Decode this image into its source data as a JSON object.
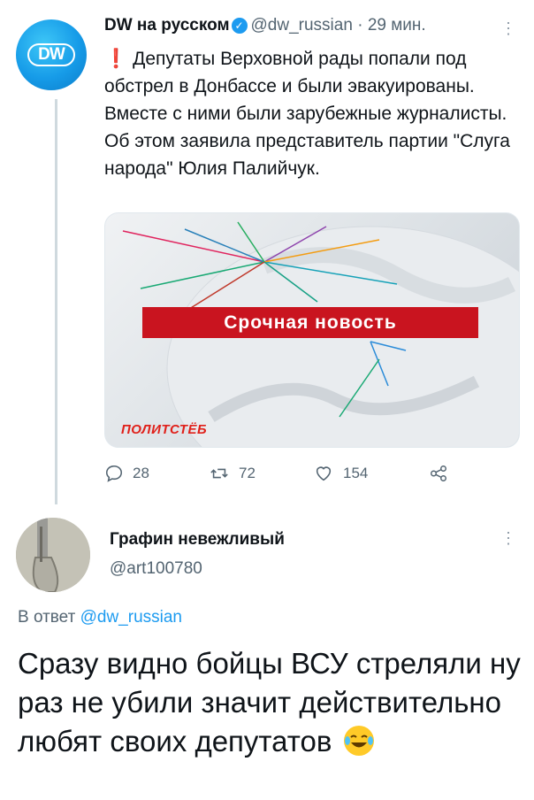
{
  "tweet": {
    "author_name": "DW на русском",
    "verified_icon": "verified-badge-icon",
    "handle": "@dw_russian",
    "separator": "·",
    "time": "29 мин.",
    "avatar_text": "DW",
    "alert_symbol": "❗",
    "text": "Депутаты Верховной рады попали под обстрел в Донбассе и были эвакуированы. Вместе с ними были зарубежные журналисты. Об этом заявила представитель партии \"Слуга народа\" Юлия Палийчук.",
    "media": {
      "banner_text": "Срочная новость",
      "watermark": "ПОЛИТСТЁБ"
    },
    "actions": {
      "replies": "28",
      "retweets": "72",
      "likes": "154"
    }
  },
  "reply": {
    "author_name": "Графин невежливый",
    "handle": "@art100780",
    "reply_prefix": "В ответ",
    "reply_to": "@dw_russian",
    "text": "Сразу видно бойцы ВСУ стреляли ну раз не убили значит действительно любят своих депутатов"
  },
  "colors": {
    "accent": "#1d9bf0",
    "muted_text": "#536471",
    "banner_red": "#c9141f",
    "thread_line": "#cfd9de"
  }
}
